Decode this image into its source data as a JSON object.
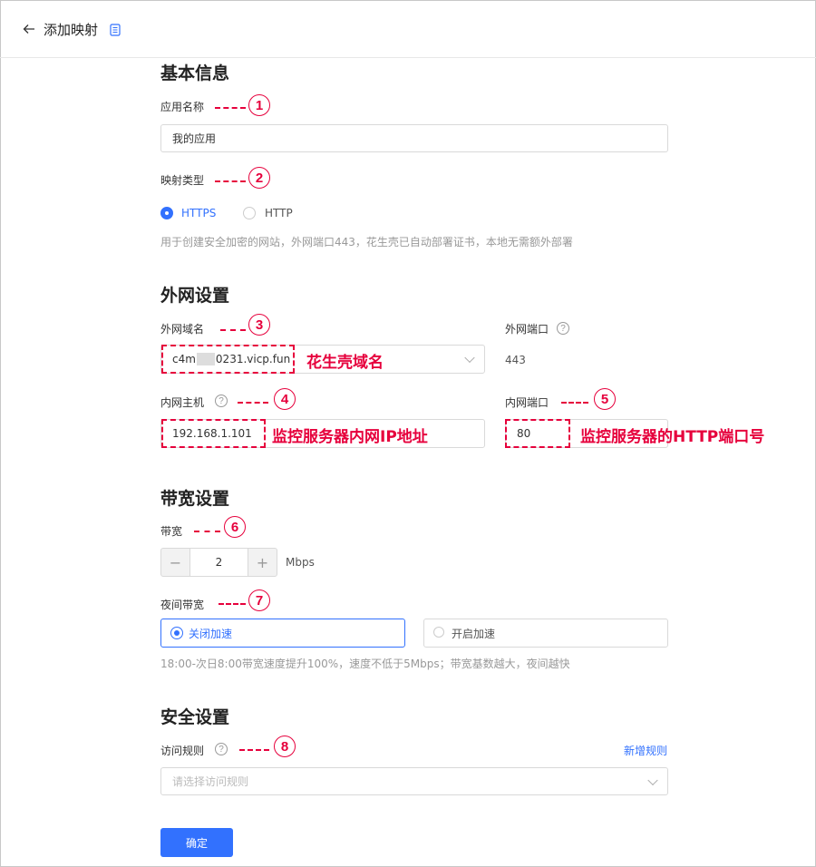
{
  "header": {
    "title": "添加映射"
  },
  "basic": {
    "section_title": "基本信息",
    "app_name_label": "应用名称",
    "app_name_value": "我的应用",
    "mapping_type_label": "映射类型",
    "options": [
      {
        "label": "HTTPS",
        "selected": true
      },
      {
        "label": "HTTP",
        "selected": false
      }
    ],
    "hint": "用于创建安全加密的网站，外网端口443，花生壳已自动部署证书，本地无需额外部署"
  },
  "external": {
    "section_title": "外网设置",
    "domain_label": "外网域名",
    "domain_value_prefix": "c4m",
    "domain_value_suffix": "0231.vicp.fun",
    "port_label": "外网端口",
    "port_value": "443",
    "host_label": "内网主机",
    "host_value": "192.168.1.101",
    "inner_port_label": "内网端口",
    "inner_port_value": "80"
  },
  "bandwidth": {
    "section_title": "带宽设置",
    "label": "带宽",
    "minus": "−",
    "value": "2",
    "plus": "+",
    "unit": "Mbps",
    "night_label": "夜间带宽",
    "night_options": [
      {
        "label": "关闭加速",
        "selected": true
      },
      {
        "label": "开启加速",
        "selected": false
      }
    ],
    "hint": "18:00-次日8:00带宽速度提升100%，速度不低于5Mbps；带宽基数越大，夜间越快"
  },
  "security": {
    "section_title": "安全设置",
    "rule_label": "访问规则",
    "add_rule_link": "新增规则",
    "rule_placeholder": "请选择访问规则"
  },
  "submit_label": "确定",
  "help_glyph": "?",
  "annotations": {
    "numbers": [
      "1",
      "2",
      "3",
      "4",
      "5",
      "6",
      "7",
      "8"
    ],
    "domain_note": "花生壳域名",
    "host_note": "监控服务器内网IP地址",
    "port_note": "监控服务器的HTTP端口号"
  },
  "colors": {
    "accent": "#3271fe",
    "annotation": "#e6003c"
  }
}
